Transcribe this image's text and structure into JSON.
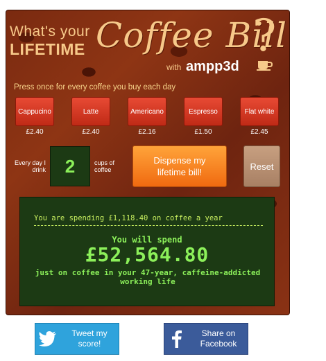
{
  "header": {
    "title_line1": "What's your",
    "title_line2": "LIFETIME",
    "title_script": "Coffee Bill",
    "question_mark": "?",
    "with_label": "with",
    "brand": "ampp3d"
  },
  "instructions": "Press once for every coffee you buy each day",
  "coffees": [
    {
      "label": "Cappucino",
      "price": "£2.40"
    },
    {
      "label": "Latte",
      "price": "£2.40"
    },
    {
      "label": "Americano",
      "price": "£2.16"
    },
    {
      "label": "Espresso",
      "price": "£1.50"
    },
    {
      "label": "Flat white",
      "price": "£2.45"
    }
  ],
  "counter": {
    "left_label": "Every day I drink",
    "value": "2",
    "right_label": "cups of coffee"
  },
  "dispense_label": "Dispense my lifetime bill!",
  "reset_label": "Reset",
  "result": {
    "year_text": "You are spending £1,118.40 on coffee a year",
    "will_spend": "You will spend",
    "total": "£52,564.80",
    "life_text": "just on coffee in your 47-year, caffeine-addicted working life"
  },
  "social": {
    "tweet_label": "Tweet my\nscore!",
    "facebook_label": "Share on\nFacebook"
  },
  "colors": {
    "accent": "#f7c98a",
    "button_red": "#d83a24",
    "dispense_orange": "#f88a20",
    "display_green": "#8cf05a",
    "twitter": "#2fa3dc",
    "facebook": "#3b5b9a"
  },
  "icons": [
    "cup-icon",
    "twitter-bird-icon",
    "facebook-f-icon"
  ]
}
